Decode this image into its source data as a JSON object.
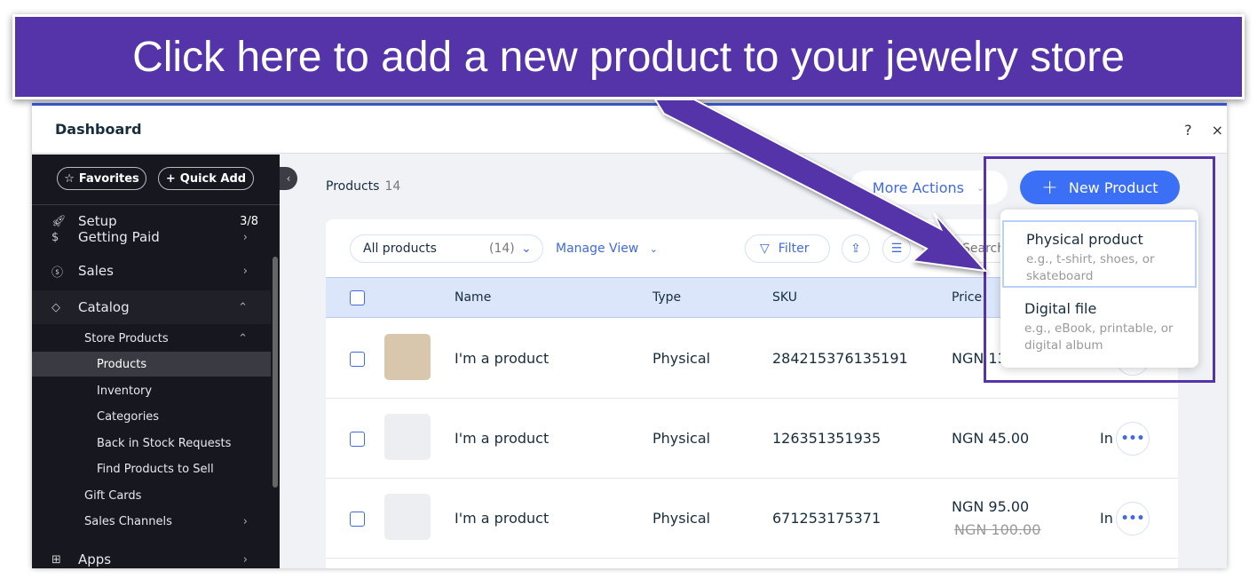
{
  "annotation": {
    "text": "Click here to add a new product to your jewelry store",
    "color": "#5533a8"
  },
  "header": {
    "title": "Dashboard",
    "help": "?",
    "close": "×"
  },
  "sidebar": {
    "favorites": "Favorites",
    "quick_add": "Quick Add",
    "items": [
      {
        "label": "Setup",
        "badge": "3/8",
        "icon": "rocket-icon"
      },
      {
        "label": "Getting Paid",
        "icon": "invoice-dollar-icon"
      },
      {
        "label": "Sales",
        "icon": "dollar-circle-icon"
      },
      {
        "label": "Catalog",
        "icon": "catalog-icon"
      },
      {
        "label": "Apps",
        "icon": "apps-icon"
      }
    ],
    "sub": [
      {
        "label": "Store Products"
      },
      {
        "label": "Products",
        "active": true
      },
      {
        "label": "Inventory"
      },
      {
        "label": "Categories"
      },
      {
        "label": "Back in Stock Requests"
      },
      {
        "label": "Find Products to Sell"
      },
      {
        "label": "Gift Cards"
      },
      {
        "label": "Sales Channels"
      }
    ]
  },
  "main": {
    "title": "Products",
    "count": "14",
    "more_actions": "More Actions",
    "new_product": "New Product",
    "filter_select": "All products",
    "filter_count": "(14)",
    "manage_view": "Manage View",
    "filter": "Filter",
    "search_placeholder": "Search...",
    "columns": [
      "Name",
      "Type",
      "SKU",
      "Price"
    ],
    "rows": [
      {
        "name": "I'm a product",
        "type": "Physical",
        "sku": "284215376135191",
        "price": "NGN 13",
        "status": ""
      },
      {
        "name": "I'm a product",
        "type": "Physical",
        "sku": "126351351935",
        "price": "NGN 45.00",
        "status": "In   k"
      },
      {
        "name": "I'm a product",
        "type": "Physical",
        "sku": "671253175371",
        "price": "NGN 95.00",
        "old_price": "NGN 100.00",
        "status": "In   k"
      }
    ]
  },
  "menu": {
    "items": [
      {
        "title": "Physical product",
        "desc": "e.g., t-shirt, shoes, or skateboard"
      },
      {
        "title": "Digital file",
        "desc": "e.g., eBook, printable, or digital album"
      }
    ]
  },
  "colors": {
    "accent": "#3b6ff5",
    "sidebar": "#17181f"
  }
}
